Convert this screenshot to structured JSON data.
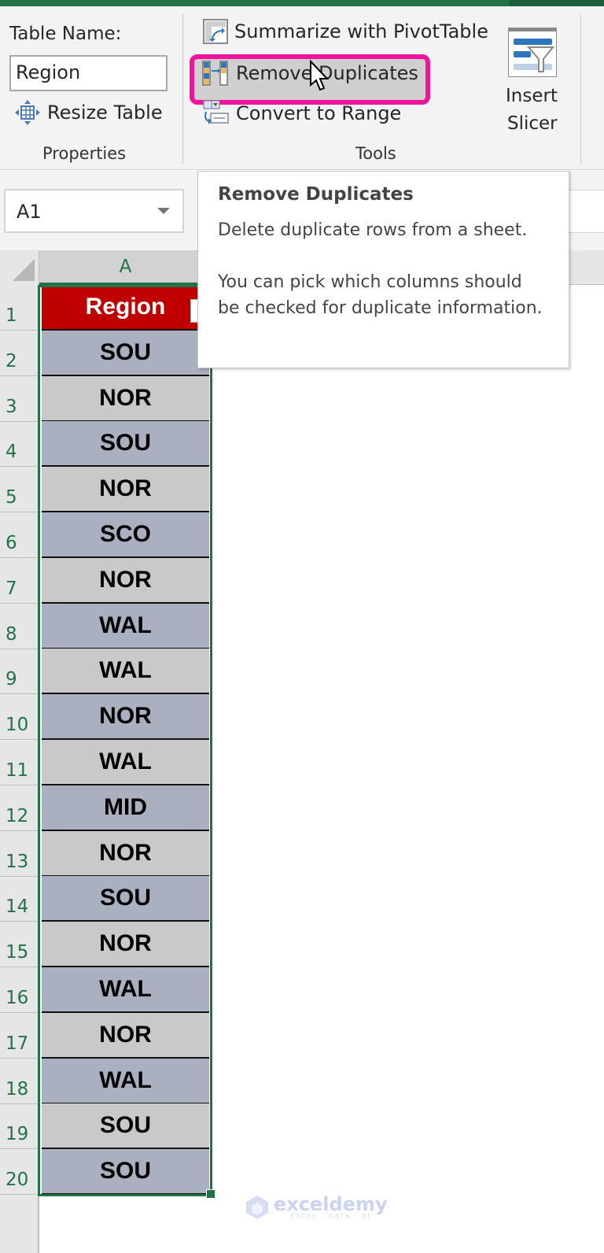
{
  "ribbon": {
    "properties": {
      "table_name_label": "Table Name:",
      "table_name_value": "Region",
      "resize_table_label": "Resize Table",
      "group_label": "Properties"
    },
    "tools": {
      "summarize_label": "Summarize with PivotTable",
      "remove_duplicates_label": "Remove Duplicates",
      "convert_to_range_label": "Convert to Range",
      "group_label": "Tools"
    },
    "insert_slicer": {
      "line1": "Insert",
      "line2": "Slicer"
    },
    "highlight_color": "#f0149c"
  },
  "name_box": {
    "value": "A1"
  },
  "tooltip": {
    "title": "Remove Duplicates",
    "line1": "Delete duplicate rows from a sheet.",
    "line2": "You can pick which columns should be checked for duplicate information."
  },
  "sheet": {
    "column_header": "A",
    "row_numbers": [
      "1",
      "2",
      "3",
      "4",
      "5",
      "6",
      "7",
      "8",
      "9",
      "10",
      "11",
      "12",
      "13",
      "14",
      "15",
      "16",
      "17",
      "18",
      "19",
      "20"
    ],
    "table_header": "Region",
    "values": [
      "SOU",
      "NOR",
      "SOU",
      "NOR",
      "SCO",
      "NOR",
      "WAL",
      "WAL",
      "NOR",
      "WAL",
      "MID",
      "NOR",
      "SOU",
      "NOR",
      "WAL",
      "NOR",
      "WAL",
      "SOU",
      "SOU"
    ],
    "colors": {
      "header_bg": "#c00000",
      "band_odd": "#aab0c0",
      "band_even": "#c9c9c9",
      "selection": "#217346"
    }
  },
  "watermark": {
    "brand": "exceldemy",
    "tagline": "EXCEL · DATA · BI"
  }
}
